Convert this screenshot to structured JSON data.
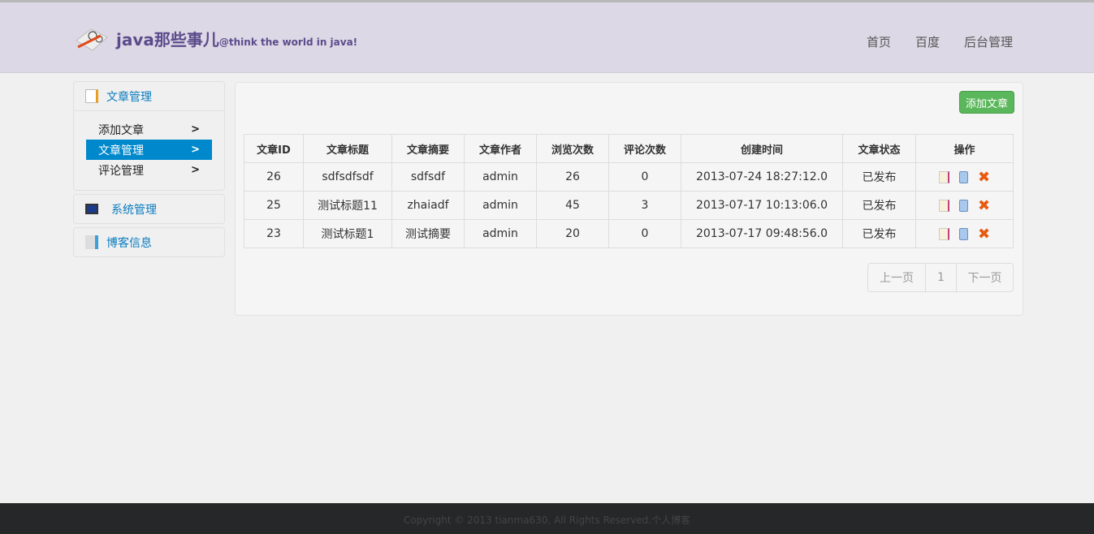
{
  "header": {
    "brand": "java那些事儿",
    "tagline": "@think the world in java!",
    "nav": [
      "首页",
      "百度",
      "后台管理"
    ]
  },
  "sidebar": {
    "groups": [
      {
        "label": "文章管理",
        "items": [
          "添加文章",
          "文章管理",
          "评论管理"
        ]
      },
      {
        "label": "系统管理"
      },
      {
        "label": "博客信息"
      }
    ]
  },
  "main": {
    "add_label": "添加文章",
    "columns": [
      "文章ID",
      "文章标题",
      "文章摘要",
      "文章作者",
      "浏览次数",
      "评论次数",
      "创建时间",
      "文章状态",
      "操作"
    ],
    "rows": [
      [
        "26",
        "sdfsdfsdf",
        "sdfsdf",
        "admin",
        "26",
        "0",
        "2013-07-24 18:27:12.0",
        "已发布"
      ],
      [
        "25",
        "测试标题11",
        "zhaiadf",
        "admin",
        "45",
        "3",
        "2013-07-17 10:13:06.0",
        "已发布"
      ],
      [
        "23",
        "测试标题1",
        "测试摘要",
        "admin",
        "20",
        "0",
        "2013-07-17 09:48:56.0",
        "已发布"
      ]
    ],
    "pager": {
      "prev": "上一页",
      "page": "1",
      "next": "下一页"
    }
  },
  "footer": {
    "text": "Copyright © 2013 tianma630, All Rights Reserved.个人博客"
  },
  "colors": {
    "accent": "#0088cc",
    "green": "#5bb75b",
    "brand": "#5a4c8c"
  }
}
